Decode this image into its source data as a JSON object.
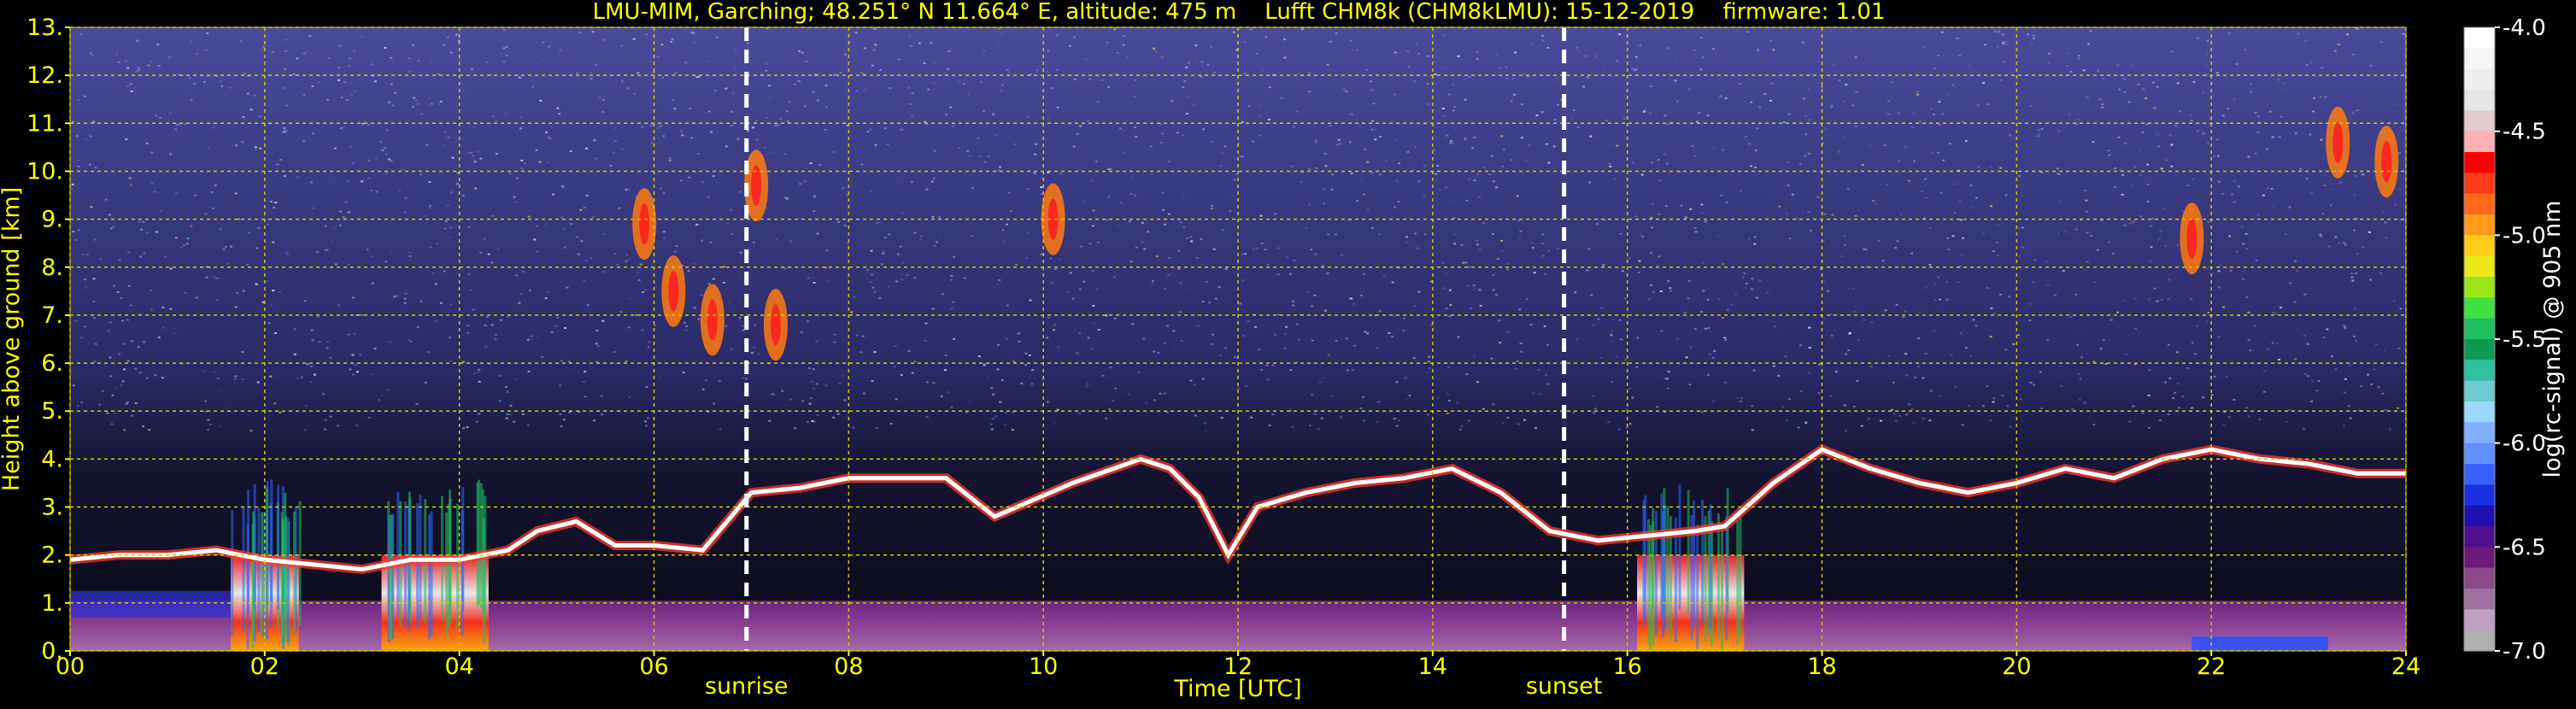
{
  "chart_data": {
    "type": "heatmap",
    "title": "LMU-MIM, Garching; 48.251° N 11.664° E, altitude: 475 m    Lufft CHM8k (CHM8kLMU): 15-12-2019    firmware: 1.01",
    "xlabel": "Time [UTC]",
    "ylabel": "Height above ground [km]",
    "xlim": [
      0,
      24
    ],
    "ylim": [
      0,
      13
    ],
    "x_ticks": [
      "00",
      "02",
      "04",
      "06",
      "08",
      "10",
      "12",
      "14",
      "16",
      "18",
      "20",
      "22",
      "24"
    ],
    "y_ticks": [
      "0.",
      "1.",
      "2.",
      "3.",
      "4.",
      "5.",
      "6.",
      "7.",
      "8.",
      "9.",
      "10.",
      "11.",
      "12.",
      "13."
    ],
    "grid": true,
    "annotations": [
      {
        "label": "sunrise",
        "x": 6.95
      },
      {
        "label": "sunset",
        "x": 15.35
      }
    ],
    "colorbar": {
      "label": "log(rc-signal) @ 905 nm",
      "range": [
        -7.0,
        -4.0
      ],
      "ticks": [
        "-4.0",
        "-4.5",
        "-5.0",
        "-5.5",
        "-6.0",
        "-6.5",
        "-7.0"
      ]
    },
    "features": {
      "cloud_layer": [
        [
          0,
          1.9
        ],
        [
          0.5,
          2.0
        ],
        [
          1,
          2.0
        ],
        [
          1.5,
          2.1
        ],
        [
          2,
          1.9
        ],
        [
          2.5,
          1.8
        ],
        [
          3,
          1.7
        ],
        [
          3.5,
          1.9
        ],
        [
          4,
          1.9
        ],
        [
          4.5,
          2.1
        ],
        [
          4.8,
          2.5
        ],
        [
          5.2,
          2.7
        ],
        [
          5.6,
          2.2
        ],
        [
          6.0,
          2.2
        ],
        [
          6.5,
          2.1
        ],
        [
          7.0,
          3.3
        ],
        [
          7.5,
          3.4
        ],
        [
          8.0,
          3.6
        ],
        [
          8.5,
          3.6
        ],
        [
          9.0,
          3.6
        ],
        [
          9.5,
          2.8
        ],
        [
          10.3,
          3.5
        ],
        [
          11.0,
          4.0
        ],
        [
          11.3,
          3.8
        ],
        [
          11.6,
          3.2
        ],
        [
          11.9,
          2.0
        ],
        [
          12.2,
          3.0
        ],
        [
          12.7,
          3.3
        ],
        [
          13.2,
          3.5
        ],
        [
          13.7,
          3.6
        ],
        [
          14.2,
          3.8
        ],
        [
          14.7,
          3.3
        ],
        [
          15.2,
          2.5
        ],
        [
          15.7,
          2.3
        ],
        [
          16.2,
          2.4
        ],
        [
          16.7,
          2.5
        ],
        [
          17.0,
          2.6
        ],
        [
          17.5,
          3.5
        ],
        [
          18.0,
          4.2
        ],
        [
          18.5,
          3.8
        ],
        [
          19.0,
          3.5
        ],
        [
          19.5,
          3.3
        ],
        [
          20.0,
          3.5
        ],
        [
          20.5,
          3.8
        ],
        [
          21.0,
          3.6
        ],
        [
          21.5,
          4.0
        ],
        [
          22.0,
          4.2
        ],
        [
          22.5,
          4.0
        ],
        [
          23.0,
          3.9
        ],
        [
          23.5,
          3.7
        ],
        [
          24,
          3.7
        ]
      ],
      "precip_blocks": [
        [
          1.65,
          2.35
        ],
        [
          3.2,
          4.3
        ],
        [
          16.1,
          17.2
        ]
      ],
      "cirrus_patches": [
        [
          5.9,
          8.9
        ],
        [
          6.2,
          7.5
        ],
        [
          6.6,
          6.9
        ],
        [
          7.05,
          9.7
        ],
        [
          7.25,
          6.8
        ],
        [
          10.1,
          9.0
        ],
        [
          23.3,
          10.6
        ],
        [
          23.8,
          10.2
        ],
        [
          21.8,
          8.6
        ]
      ]
    }
  }
}
